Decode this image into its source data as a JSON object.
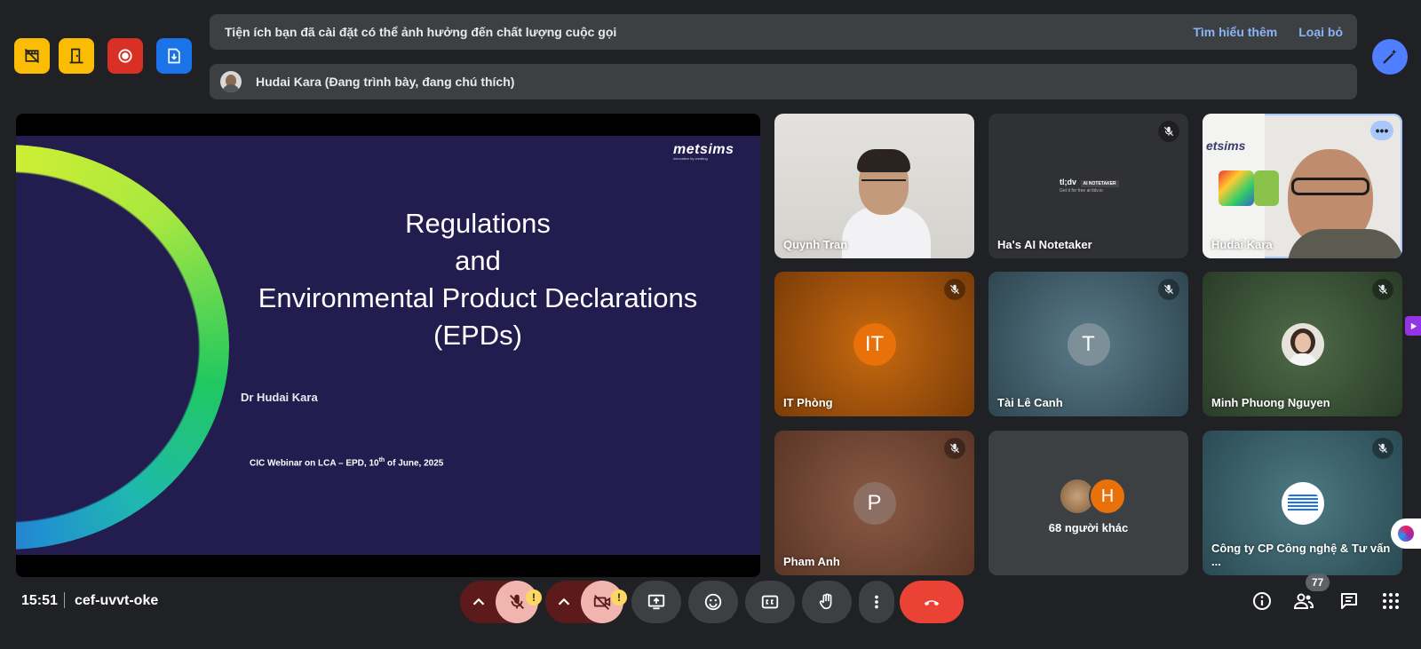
{
  "banner_notice": {
    "text": "Tiện ích bạn đã cài đặt có thể ảnh hưởng đến chất lượng cuộc gọi",
    "learn_more": "Tìm hiểu thêm",
    "dismiss": "Loại bỏ"
  },
  "presenter_banner": {
    "text": "Hudai Kara (Đang trình bày, đang chú thích)"
  },
  "slide": {
    "logo": "metsims",
    "logo_tagline": "innovative by creating",
    "title_lines": [
      "Regulations",
      "and",
      "Environmental Product Declarations",
      "(EPDs)"
    ],
    "author": "Dr Hudai Kara",
    "event_prefix": "CIC Webinar on LCA – EPD, 10",
    "event_sup": "th",
    "event_suffix": " of June, 2025"
  },
  "tiles": [
    {
      "name": "Quynh Tran"
    },
    {
      "name": "Ha's AI Notetaker",
      "brand": "tl;dv",
      "brand_tag": "AI NOTETAKER",
      "brand_sub": "Get it for free at tldv.io"
    },
    {
      "name": "Hudai Kara"
    },
    {
      "name": "IT Phòng",
      "initials": "IT"
    },
    {
      "name": "Tài Lê Canh",
      "initials": "T"
    },
    {
      "name": "Minh Phuong Nguyen"
    },
    {
      "name": "Pham Anh",
      "initials": "P"
    },
    {
      "name": "68 người khác",
      "initials": "H"
    },
    {
      "name": "Công ty CP Công nghệ & Tư vấn ..."
    }
  ],
  "bottom": {
    "time": "15:51",
    "meeting_code": "cef-uvvt-oke",
    "participant_count": "77",
    "warning_mark": "!"
  },
  "colors": {
    "background": "#202124",
    "host_yellow": "#fbbc04",
    "record_red": "#d93025",
    "blue": "#1a73e8",
    "end_call": "#ea4335",
    "link": "#8ab4f8"
  }
}
